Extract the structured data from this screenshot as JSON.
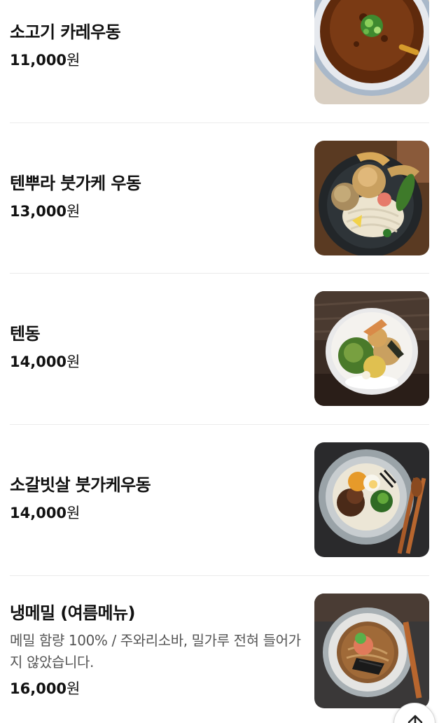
{
  "menu": {
    "items": [
      {
        "name": "소고기 카레우동",
        "description": "",
        "price": "11,000",
        "currency": "원",
        "photo": "curry-udon-photo"
      },
      {
        "name": "텐뿌라 붓가케 우동",
        "description": "",
        "price": "13,000",
        "currency": "원",
        "photo": "tempura-bukkake-udon-photo"
      },
      {
        "name": "텐동",
        "description": "",
        "price": "14,000",
        "currency": "원",
        "photo": "tendon-photo"
      },
      {
        "name": "소갈빗살 붓가케우동",
        "description": "",
        "price": "14,000",
        "currency": "원",
        "photo": "beef-rib-bukkake-udon-photo"
      },
      {
        "name": "냉메밀 (여름메뉴)",
        "description": "메밀 함량 100% / 주와리소바, 밀가루 전혀 들어가지 않았습니다.",
        "price": "16,000",
        "currency": "원",
        "photo": "cold-soba-photo"
      }
    ]
  },
  "scroll_top": {
    "icon": "arrow-up-icon"
  }
}
